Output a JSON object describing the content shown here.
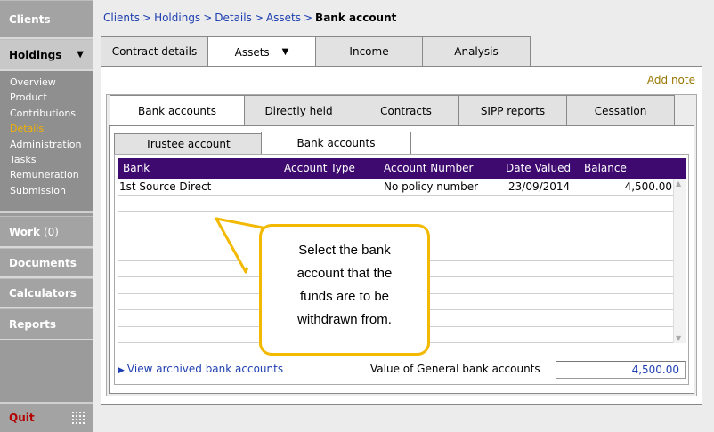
{
  "sidebar": {
    "clients": "Clients",
    "holdings": "Holdings",
    "holdings_caret": "▼",
    "sub_items": [
      "Overview",
      "Product",
      "Contributions",
      "Details",
      "Administration",
      "Tasks",
      "Remuneration",
      "Submission"
    ],
    "active_sub_item": "Details",
    "work": "Work",
    "work_count": "(0)",
    "documents": "Documents",
    "calculators": "Calculators",
    "reports": "Reports",
    "quit": "Quit"
  },
  "breadcrumb": {
    "items": [
      "Clients",
      "Holdings",
      "Details",
      "Assets"
    ],
    "separator": ">",
    "current": "Bank account"
  },
  "top_tabs": {
    "contract_details": "Contract details",
    "assets": "Assets",
    "assets_caret": "▼",
    "income": "Income",
    "analysis": "Analysis"
  },
  "add_note": "Add note",
  "sub_tabs": [
    "Bank accounts",
    "Directly held",
    "Contracts",
    "SIPP reports",
    "Cessation"
  ],
  "account_tabs": [
    "Trustee account",
    "Bank accounts"
  ],
  "grid": {
    "columns": [
      "Bank",
      "Account Type",
      "Account Number",
      "Date Valued",
      "Balance"
    ],
    "rows": [
      {
        "bank": "1st Source Direct",
        "account_type": "",
        "account_number": "No policy number",
        "date_valued": "23/09/2014",
        "balance": "4,500.00"
      }
    ]
  },
  "footer": {
    "view_archived": "View archived bank accounts",
    "value_label": "Value of General bank accounts",
    "value": "4,500.00"
  },
  "callout": {
    "lines": [
      "Select the bank",
      "account that the",
      "funds are to be",
      "withdrawn from."
    ]
  },
  "colors": {
    "header_purple": "#3e0a70",
    "link_blue": "#1e3fb0",
    "callout_border": "#f3b900",
    "active_orange": "#f3b000",
    "quit_red": "#b40000"
  }
}
